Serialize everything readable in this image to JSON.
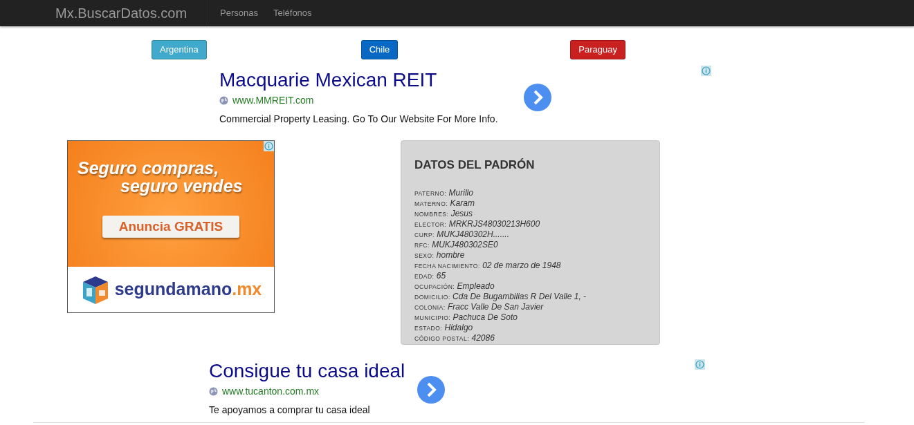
{
  "navbar": {
    "brand": "Mx.BuscarDatos.com",
    "links": [
      "Personas",
      "Teléfonos"
    ]
  },
  "country_buttons": [
    {
      "label": "Argentina",
      "color": "#41a9cc"
    },
    {
      "label": "Chile",
      "color": "#0968c3"
    },
    {
      "label": "Paraguay",
      "color": "#c92020"
    }
  ],
  "ad_top": {
    "title": "Macquarie Mexican REIT",
    "url": "www.MMREIT.com",
    "description": "Commercial Property Leasing. Go To Our Website For More Info."
  },
  "banner_ad": {
    "headline_lines": [
      "Seguro compras,",
      "seguro vendes"
    ],
    "cta": "Anuncia GRATIS",
    "logo_text": "segundamano",
    "logo_suffix": ".mx"
  },
  "record_card": {
    "title": "DATOS DEL PADRÓN",
    "fields": [
      {
        "label": "PATERNO:",
        "value": "Murillo"
      },
      {
        "label": "MATERNO:",
        "value": "Karam"
      },
      {
        "label": "NOMBRES:",
        "value": "Jesus"
      },
      {
        "label": "ELECTOR:",
        "value": "MRKRJS48030213H600"
      },
      {
        "label": "CURP:",
        "value": "MUKJ480302H......."
      },
      {
        "label": "RFC:",
        "value": "MUKJ480302SE0"
      },
      {
        "label": "SEXO:",
        "value": "hombre"
      },
      {
        "label": "FECHA NACIMIENTO:",
        "value": "02 de marzo de 1948"
      },
      {
        "label": "EDAD:",
        "value": "65"
      },
      {
        "label": "OCUPACIÓN:",
        "value": "Empleado"
      },
      {
        "label": "DOMICILIO:",
        "value": "Cda De Bugambilias R Del Valle 1, -"
      },
      {
        "label": "COLONIA:",
        "value": "Fracc Valle De San Javier"
      },
      {
        "label": "MUNICIPIO:",
        "value": "Pachuca De Soto"
      },
      {
        "label": "ESTADO:",
        "value": "Hidalgo"
      },
      {
        "label": "CÓDIGO POSTAL:",
        "value": "42086"
      }
    ]
  },
  "ad_bottom": {
    "title": "Consigue tu casa ideal",
    "url": "www.tucanton.com.mx",
    "description": "Te apoyamos a comprar tu casa ideal"
  }
}
